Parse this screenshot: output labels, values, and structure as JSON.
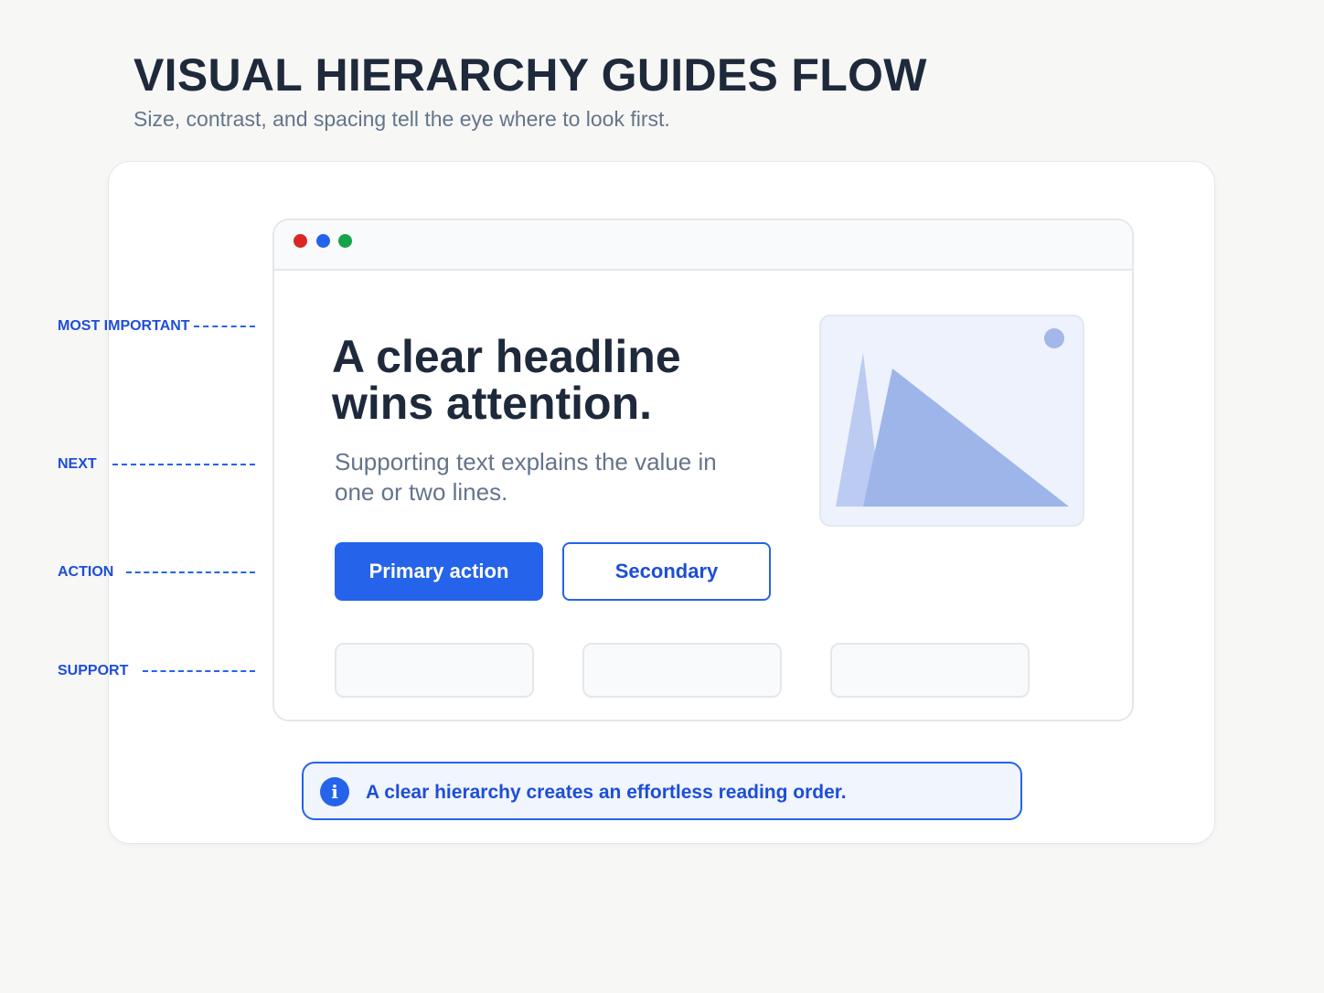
{
  "title": "VISUAL HIERARCHY GUIDES FLOW",
  "subtitle": "Size, contrast, and spacing tell the eye where to look first.",
  "annotations": {
    "most_important": "MOST IMPORTANT",
    "next": "NEXT",
    "action": "ACTION",
    "support": "SUPPORT"
  },
  "browser": {
    "window_dots": [
      "#dc2626",
      "#2563eb",
      "#16a34a"
    ],
    "headline": "A clear headline wins attention.",
    "supporting_text": "Supporting text explains the value in one or two lines.",
    "primary_button": "Primary action",
    "secondary_button": "Secondary",
    "image_icon": "image-placeholder-icon"
  },
  "callout": {
    "icon": "info-icon",
    "icon_glyph": "i",
    "text": "A clear hierarchy creates an effortless reading order."
  },
  "colors": {
    "accent": "#2563eb",
    "heading": "#1e293b",
    "muted": "#64748b"
  }
}
